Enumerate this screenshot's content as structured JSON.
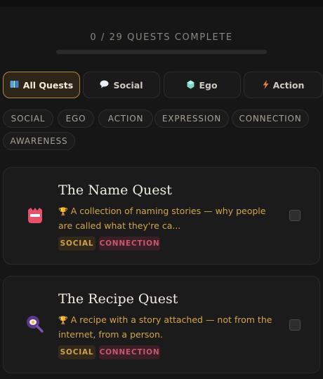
{
  "progress": {
    "label": "0 / 29 QUESTS COMPLETE",
    "completed": 0,
    "total": 29,
    "fill_color": "#d8a24a"
  },
  "filters": [
    {
      "label": "All Quests",
      "icon": "book-icon",
      "active": true
    },
    {
      "label": "Social",
      "icon": "speech-bubble-icon",
      "active": false
    },
    {
      "label": "Ego",
      "icon": "crystal-icon",
      "active": false
    },
    {
      "label": "Action",
      "icon": "lightning-icon",
      "active": false
    }
  ],
  "tags": [
    "SOCIAL",
    "EGO",
    "ACTION",
    "EXPRESSION",
    "CONNECTION",
    "AWARENESS"
  ],
  "quests": [
    {
      "title": "The Name Quest",
      "icon": "name-badge-icon",
      "description": "A collection of naming stories — why people are called what they're ca...",
      "chips": [
        "SOCIAL",
        "CONNECTION"
      ],
      "done": false
    },
    {
      "title": "The Recipe Quest",
      "icon": "egg-magnifier-icon",
      "description": "A recipe with a story attached — not from the internet, from a person.",
      "chips": [
        "SOCIAL",
        "CONNECTION"
      ],
      "done": false
    }
  ],
  "colors": {
    "accent": "#d8a24a",
    "social_chip": "#d0a14c",
    "connection_chip": "#c5586e"
  }
}
